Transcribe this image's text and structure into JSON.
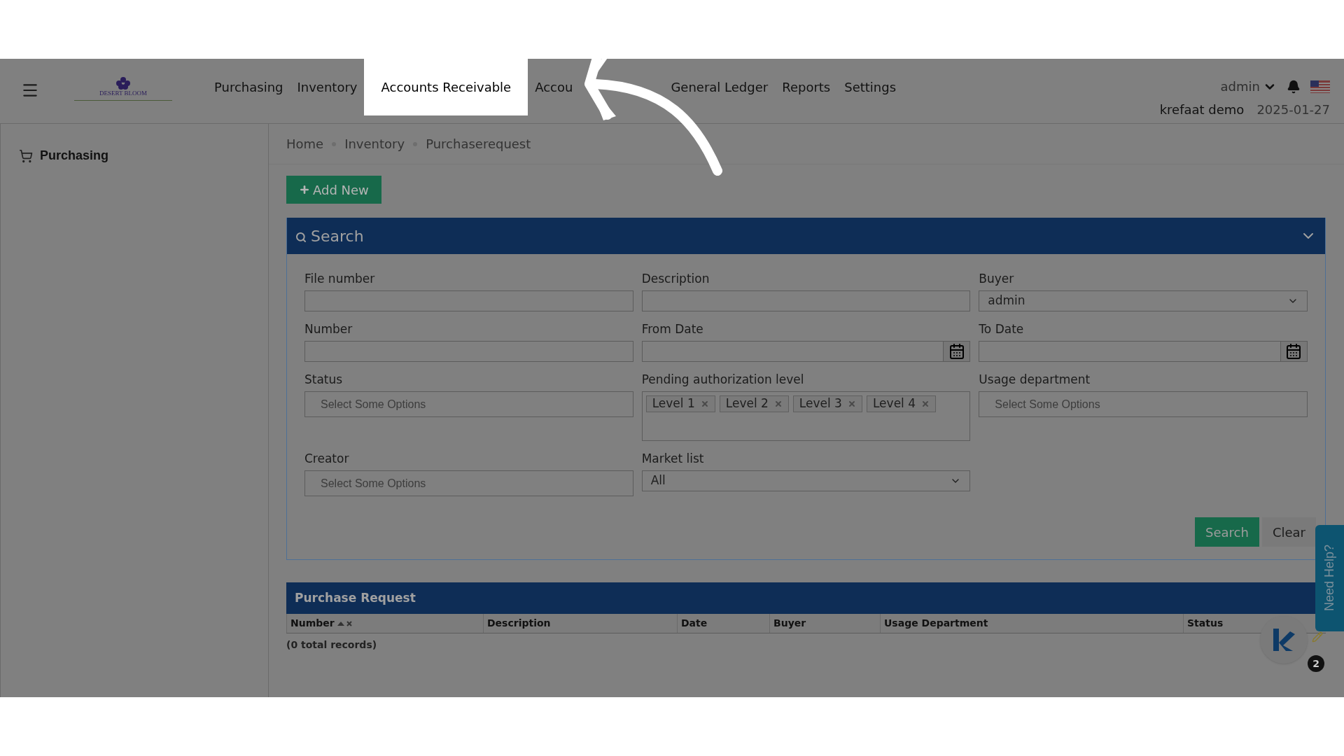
{
  "header": {
    "logo_text": "DESERT BLOOM",
    "nav": [
      {
        "label": "Purchasing",
        "highlighted": false
      },
      {
        "label": "Inventory",
        "highlighted": false
      },
      {
        "label": "Accounts Receivable",
        "highlighted": true
      },
      {
        "label": "Accou",
        "highlighted": false
      },
      {
        "label": "General Ledger",
        "highlighted": false
      },
      {
        "label": "Reports",
        "highlighted": false
      },
      {
        "label": "Settings",
        "highlighted": false
      }
    ],
    "user": "admin",
    "company": "krefaat demo",
    "date": "2025-01-27"
  },
  "sidebar": {
    "items": [
      {
        "label": "Purchasing"
      }
    ]
  },
  "breadcrumb": [
    "Home",
    "Inventory",
    "Purchaserequest"
  ],
  "add_button": "Add New",
  "search_panel": {
    "title": "Search",
    "fields": [
      {
        "label": "File number",
        "kind": "text"
      },
      {
        "label": "Description",
        "kind": "text"
      },
      {
        "label": "Buyer",
        "kind": "select",
        "value": "admin"
      },
      {
        "label": "Number",
        "kind": "text"
      },
      {
        "label": "From Date",
        "kind": "date"
      },
      {
        "label": "To Date",
        "kind": "date"
      },
      {
        "label": "Status",
        "kind": "multiselect",
        "placeholder": "Select Some Options"
      },
      {
        "label": "Pending authorization level",
        "kind": "tags",
        "tags": [
          "Level 1",
          "Level 2",
          "Level 3",
          "Level 4"
        ]
      },
      {
        "label": "Usage department",
        "kind": "multiselect",
        "placeholder": "Select Some Options"
      },
      {
        "label": "Creator",
        "kind": "multiselect",
        "placeholder": "Select Some Options"
      },
      {
        "label": "Market list",
        "kind": "select",
        "value": "All"
      }
    ],
    "buttons": [
      {
        "label": "Search",
        "kind": "primary"
      },
      {
        "label": "Clear",
        "kind": "secondary"
      }
    ]
  },
  "table": {
    "title": "Purchase Request",
    "columns": [
      {
        "label": "Number",
        "sorted": true
      },
      {
        "label": "Description",
        "sorted": false
      },
      {
        "label": "Date",
        "sorted": false
      },
      {
        "label": "Buyer",
        "sorted": false
      },
      {
        "label": "Usage Department",
        "sorted": false
      },
      {
        "label": "Status",
        "sorted": false
      }
    ],
    "footer": "(0 total records)"
  },
  "help_tab": "Need Help?",
  "chat_badge": "2"
}
